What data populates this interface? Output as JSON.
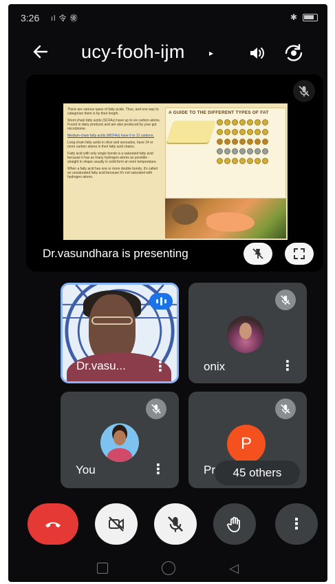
{
  "status_bar": {
    "time": "3:26",
    "signal_text": "ıl 令 ㊝",
    "bluetooth": "✱"
  },
  "header": {
    "meeting_code": "ucy-fooh-ijm",
    "caret": "▸"
  },
  "presentation": {
    "presenting_label": "Dr.vasundhara is presenting",
    "slide": {
      "bullets": [
        "There are various types of fatty acids. Thus, and one way to categorize them is by their length.",
        "Short-chain fatty acids (SCFAs) have up to six carbon atoms. Found in dairy products and are also produced by your gut microbiome.",
        "Medium-chain fatty acids (MCFAs) have 6 to 12 carbons.",
        "Long-chain fatty acids in olive and avocados, have 14 or more carbon atoms in their fatty acid chains.",
        "Fatty acid with only single bonds is a saturated fatty acid because it has as many hydrogen atoms as possible - straight in shape usually in solid form at room temperature.",
        "When a fatty acid has one or more double bonds, it's called an unsaturated fatty acid because it's not saturated with hydrogen atoms."
      ],
      "chart_title": "A GUIDE TO THE DIFFERENT TYPES OF FAT"
    }
  },
  "participants": [
    {
      "name": "Dr.vasu...",
      "speaking": true
    },
    {
      "name": "onix",
      "speaking": false
    },
    {
      "name": "You",
      "speaking": false
    },
    {
      "name": "Pro",
      "initial": "P",
      "speaking": false
    }
  ],
  "others_chip": "45 others",
  "tile_more_symbol": "⋮",
  "controls": {
    "more_symbol": "⋮"
  },
  "colors": {
    "end_call": "#e53935",
    "speaking_border": "#8ab4f8",
    "tile_bg": "#3c4043",
    "avatar_p": "#f4511e",
    "speak_badge": "#1a73e8"
  },
  "icons": {
    "back": "back-arrow-icon",
    "speaker": "speaker-icon",
    "switch_camera": "switch-camera-icon",
    "mic_off": "mic-off-icon",
    "pin_off": "pin-off-icon",
    "fullscreen": "fullscreen-icon",
    "end_call": "phone-hangup-icon",
    "camera_off": "camera-off-icon",
    "raise_hand": "raise-hand-icon",
    "more": "more-vertical-icon"
  }
}
